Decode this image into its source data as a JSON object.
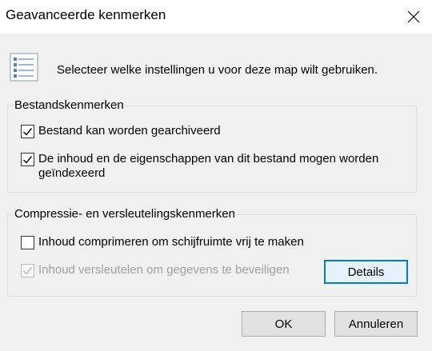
{
  "window": {
    "title": "Geavanceerde kenmerken",
    "close_icon": "close-icon"
  },
  "header": {
    "icon": "properties-list-icon",
    "text": "Selecteer welke instellingen u voor deze map wilt gebruiken."
  },
  "file_attributes": {
    "group_label": "Bestandskenmerken",
    "archive": {
      "label": "Bestand kan worden gearchiveerd",
      "checked": true
    },
    "index": {
      "label_line1": "De inhoud en de eigenschappen van dit bestand mogen worden",
      "label_line2": "geïndexeerd",
      "checked": true
    }
  },
  "compress_encrypt": {
    "group_label": "Compressie- en versleutelingskenmerken",
    "compress": {
      "label": "Inhoud comprimeren om schijfruimte vrij te maken",
      "checked": false
    },
    "encrypt": {
      "label": "Inhoud versleutelen om gegevens te beveiligen",
      "checked": true,
      "disabled": true
    },
    "details_label": "Details"
  },
  "buttons": {
    "ok_label": "OK",
    "cancel_label": "Annuleren"
  },
  "colors": {
    "accent": "#0078d7",
    "dialog_bg": "#f0f0f0",
    "icon_blue": "#4a7fc1"
  }
}
